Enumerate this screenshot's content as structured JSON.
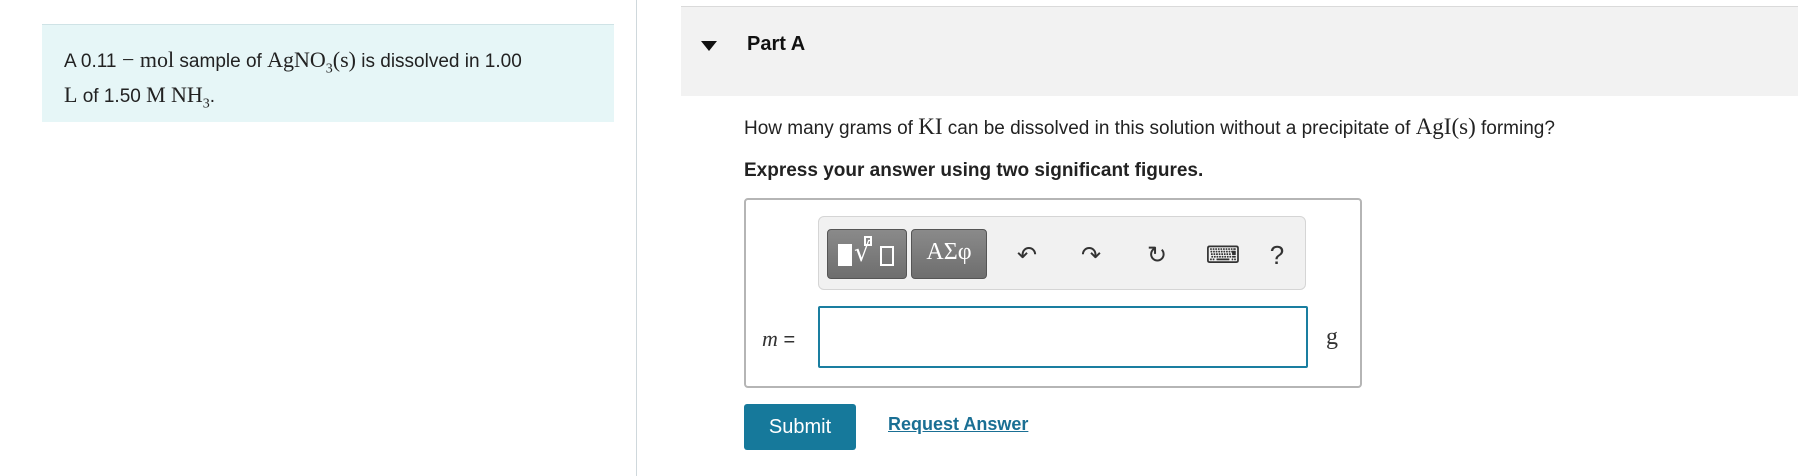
{
  "intro": {
    "prefix": "A 0.11",
    "dash": " − ",
    "mol_unit": "mol",
    "mid1": " sample of ",
    "formula1_main": "AgNO",
    "formula1_sub": "3",
    "formula1_state": "(s)",
    "mid2": " is dissolved in 1.00 ",
    "unit_L": "L",
    "mid3": " of 1.50 ",
    "unit_M": "M",
    "space": " ",
    "formula2_main": "NH",
    "formula2_sub": "3",
    "end": "."
  },
  "part": {
    "title": "Part A"
  },
  "question": {
    "pre": "How many grams of ",
    "compound": "KI",
    "mid": " can be dissolved in this solution without a precipitate of ",
    "precipitate": "AgI(s)",
    "post": " forming?"
  },
  "instruction": "Express your answer using two significant figures.",
  "toolbar": {
    "greek_label": "ΑΣφ",
    "undo_glyph": "↶",
    "redo_glyph": "↷",
    "reset_glyph": "↻",
    "keyboard_glyph": "⌨",
    "help_label": "?"
  },
  "answer": {
    "variable": "m",
    "equals": " =",
    "value": "",
    "unit": "g"
  },
  "buttons": {
    "submit_label": "Submit",
    "request_label": "Request Answer"
  },
  "colors": {
    "accent": "#16799b",
    "intro_bg": "#e6f6f7",
    "header_bg": "#f2f2f2"
  }
}
